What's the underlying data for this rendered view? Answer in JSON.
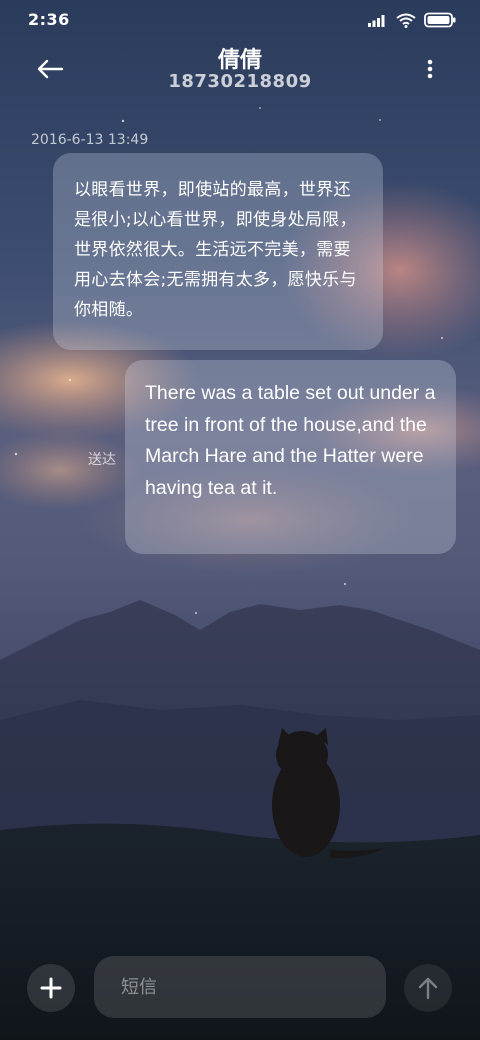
{
  "status_bar": {
    "time": "2:36",
    "icons": [
      "signal-icon",
      "wifi-icon",
      "battery-icon"
    ]
  },
  "header": {
    "back_icon": "back-arrow-icon",
    "contact_name": "倩倩",
    "phone_number": "18730218809",
    "menu_icon": "more-vertical-icon"
  },
  "conversation": {
    "timestamp": "2016-6-13 13:49",
    "messages": [
      {
        "direction": "incoming",
        "text": "以眼看世界，即使站的最高，世界还是很小;以心看世界，即使身处局限，世界依然很大。生活远不完美，需要用心去体会;无需拥有太多，愿快乐与你相随。"
      },
      {
        "direction": "outgoing",
        "text": "There was a table set out under a tree in front of the house,and the March Hare and the Hatter were having tea at it.",
        "status": "送达"
      }
    ]
  },
  "composer": {
    "add_icon": "plus-icon",
    "placeholder": "短信",
    "value": "",
    "send_icon": "send-arrow-up-icon"
  },
  "colors": {
    "sky_top": "#2e3f60",
    "sky_mid": "#4a5476",
    "cloud_glow": "#d59a7f",
    "mountain": "#2f3550",
    "ground": "#141a20",
    "bubble": "#d7deee"
  }
}
